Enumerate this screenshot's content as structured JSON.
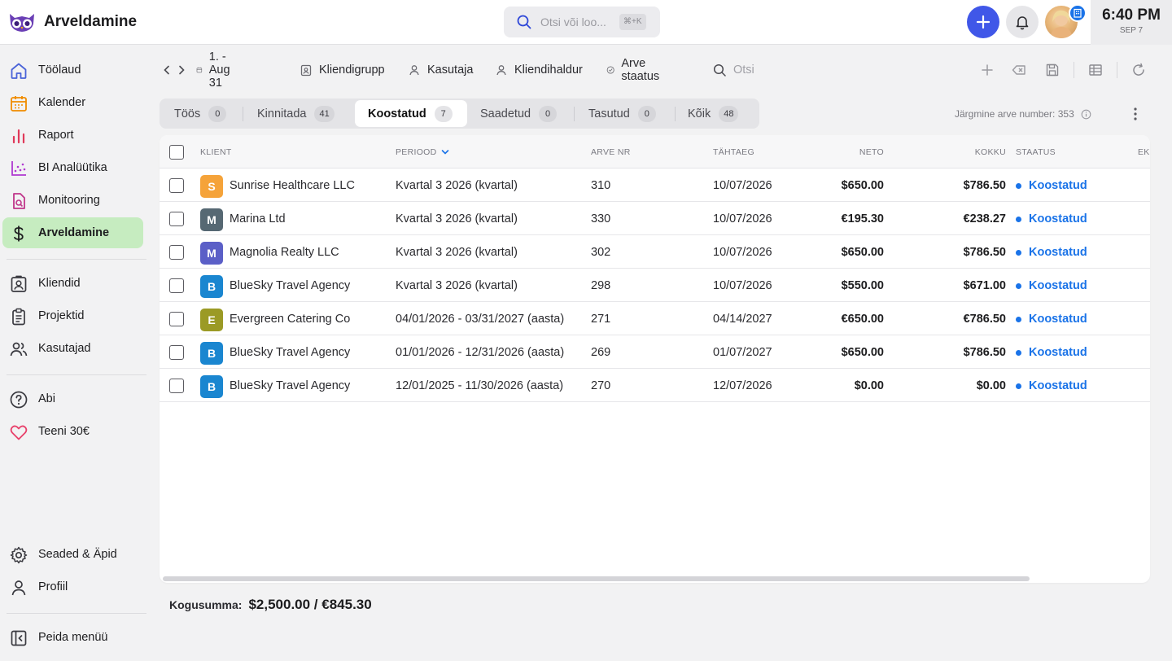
{
  "app": {
    "title": "Arveldamine"
  },
  "search": {
    "placeholder": "Otsi või loo...",
    "shortcut": "⌘+K"
  },
  "clock": {
    "time": "6:40 PM",
    "date": "SEP 7"
  },
  "sidebar": {
    "items": [
      {
        "label": "Töölaud",
        "icon": "home-icon"
      },
      {
        "label": "Kalender",
        "icon": "calendar-icon"
      },
      {
        "label": "Raport",
        "icon": "bar-chart-icon"
      },
      {
        "label": "BI Analüütika",
        "icon": "scatter-chart-icon"
      },
      {
        "label": "Monitooring",
        "icon": "document-search-icon"
      },
      {
        "label": "Arveldamine",
        "icon": "dollar-icon",
        "active": true
      },
      {
        "label": "Kliendid",
        "icon": "client-badge-icon"
      },
      {
        "label": "Projektid",
        "icon": "clipboard-icon"
      },
      {
        "label": "Kasutajad",
        "icon": "users-icon"
      },
      {
        "label": "Abi",
        "icon": "help-icon"
      },
      {
        "label": "Teeni 30€",
        "icon": "heart-icon"
      },
      {
        "label": "Seaded & Äpid",
        "icon": "gear-icon"
      },
      {
        "label": "Profiil",
        "icon": "user-icon"
      },
      {
        "label": "Peida menüü",
        "icon": "collapse-sidebar-icon"
      }
    ],
    "colors": {
      "active_bg": "#c6ecc0"
    }
  },
  "filters": {
    "date_range": "1. - Aug 31",
    "client_group": "Kliendigrupp",
    "user": "Kasutaja",
    "client_manager": "Kliendihaldur",
    "invoice_status": "Arve staatus",
    "search_placeholder": "Otsi"
  },
  "tabs": [
    {
      "label": "Töös",
      "count": "0"
    },
    {
      "label": "Kinnitada",
      "count": "41"
    },
    {
      "label": "Koostatud",
      "count": "7",
      "active": true
    },
    {
      "label": "Saadetud",
      "count": "0"
    },
    {
      "label": "Tasutud",
      "count": "0"
    },
    {
      "label": "Kõik",
      "count": "48"
    }
  ],
  "next_invoice": "Järgmine arve number: 353",
  "table": {
    "columns": {
      "client": "KLIENT",
      "period": "PERIOOD",
      "invoice_no": "ARVE NR",
      "due": "TÄHTAEG",
      "net": "NETO",
      "total": "KOKKU",
      "status": "STAATUS",
      "extra": "EK"
    },
    "rows": [
      {
        "initial": "S",
        "color": "#f5a33a",
        "client": "Sunrise Healthcare LLC",
        "period": "Kvartal 3 2026 (kvartal)",
        "invoice_no": "310",
        "due": "10/07/2026",
        "net": "$650.00",
        "total": "$786.50",
        "status": "Koostatud"
      },
      {
        "initial": "M",
        "color": "#566873",
        "client": "Marina Ltd",
        "period": "Kvartal 3 2026 (kvartal)",
        "invoice_no": "330",
        "due": "10/07/2026",
        "net": "€195.30",
        "total": "€238.27",
        "status": "Koostatud"
      },
      {
        "initial": "M",
        "color": "#5b5fc7",
        "client": "Magnolia Realty LLC",
        "period": "Kvartal 3 2026 (kvartal)",
        "invoice_no": "302",
        "due": "10/07/2026",
        "net": "$650.00",
        "total": "$786.50",
        "status": "Koostatud"
      },
      {
        "initial": "B",
        "color": "#1a86d0",
        "client": "BlueSky Travel Agency",
        "period": "Kvartal 3 2026 (kvartal)",
        "invoice_no": "298",
        "due": "10/07/2026",
        "net": "$550.00",
        "total": "$671.00",
        "status": "Koostatud"
      },
      {
        "initial": "E",
        "color": "#9b9a25",
        "client": "Evergreen Catering Co",
        "period": "04/01/2026 - 03/31/2027 (aasta)",
        "invoice_no": "271",
        "due": "04/14/2027",
        "net": "€650.00",
        "total": "€786.50",
        "status": "Koostatud"
      },
      {
        "initial": "B",
        "color": "#1a86d0",
        "client": "BlueSky Travel Agency",
        "period": "01/01/2026 - 12/31/2026 (aasta)",
        "invoice_no": "269",
        "due": "01/07/2027",
        "net": "$650.00",
        "total": "$786.50",
        "status": "Koostatud"
      },
      {
        "initial": "B",
        "color": "#1a86d0",
        "client": "BlueSky Travel Agency",
        "period": "12/01/2025 - 11/30/2026 (aasta)",
        "invoice_no": "270",
        "due": "12/07/2026",
        "net": "$0.00",
        "total": "$0.00",
        "status": "Koostatud"
      }
    ]
  },
  "summary": {
    "label": "Kogusumma:",
    "value": "$2,500.00 / €845.30"
  },
  "colors": {
    "accent": "#4057e8",
    "status_blue": "#1a73e8"
  }
}
